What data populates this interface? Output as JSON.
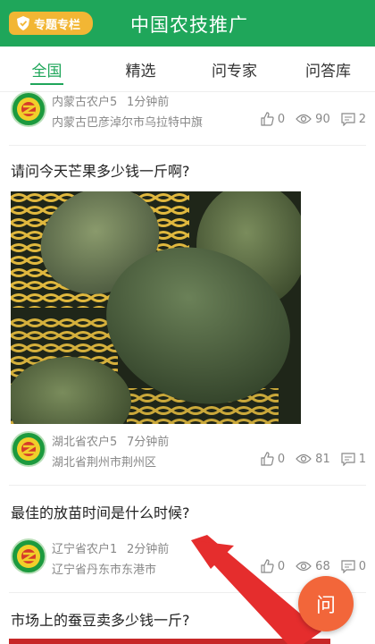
{
  "header": {
    "special_label": "专题专栏",
    "title": "中国农技推广"
  },
  "tabs": [
    {
      "label": "全国",
      "active": true
    },
    {
      "label": "精选",
      "active": false
    },
    {
      "label": "问专家",
      "active": false
    },
    {
      "label": "问答库",
      "active": false
    }
  ],
  "posts": [
    {
      "user": "内蒙古农户5",
      "time": "1分钟前",
      "location": "内蒙古巴彦淖尔市乌拉特中旗",
      "likes": "0",
      "views": "90",
      "comments": "2"
    },
    {
      "question": "请问今天芒果多少钱一斤啊?",
      "image": "mango-photo",
      "user": "湖北省农户5",
      "time": "7分钟前",
      "location": "湖北省荆州市荆州区",
      "likes": "0",
      "views": "81",
      "comments": "1"
    },
    {
      "question": "最佳的放苗时间是什么时候?",
      "user": "辽宁省农户1",
      "time": "2分钟前",
      "location": "辽宁省丹东市东港市",
      "likes": "0",
      "views": "68",
      "comments": "0"
    },
    {
      "question": "市场上的蚕豆卖多少钱一斤?"
    }
  ],
  "fab": {
    "label": "问"
  },
  "colors": {
    "primary": "#1fa65a",
    "accent": "#f2b634",
    "fab": "#f2663a",
    "arrow": "#e52d2d"
  }
}
